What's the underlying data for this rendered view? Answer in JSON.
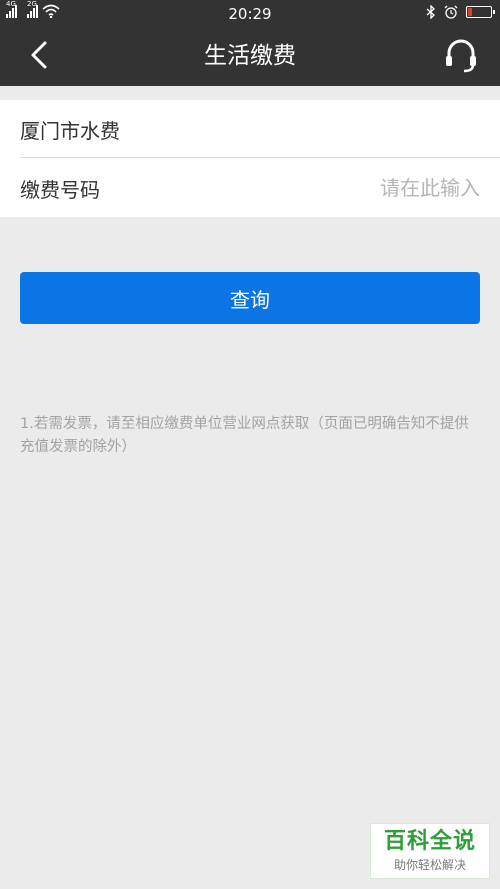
{
  "status_bar": {
    "time": "20:29",
    "signal1_label": "4G",
    "signal2_label": "2G",
    "icons": [
      "signal-icon",
      "signal-icon",
      "wifi-icon",
      "bluetooth-icon",
      "alarm-icon",
      "battery-icon"
    ],
    "battery_color": "#e23b2e"
  },
  "header": {
    "title": "生活缴费",
    "back_icon": "chevron-left-icon",
    "service_icon": "headset-icon",
    "background": "#333333"
  },
  "form": {
    "company": "厦门市水费",
    "account_label": "缴费号码",
    "account_placeholder": "请在此输入"
  },
  "query_button": {
    "label": "查询",
    "color": "#0c75e6"
  },
  "note": "1.若需发票，请至相应缴费单位营业网点获取（页面已明确告知不提供充值发票的除外）",
  "watermark": {
    "main": "百科全说",
    "sub": "助你轻松解决"
  }
}
